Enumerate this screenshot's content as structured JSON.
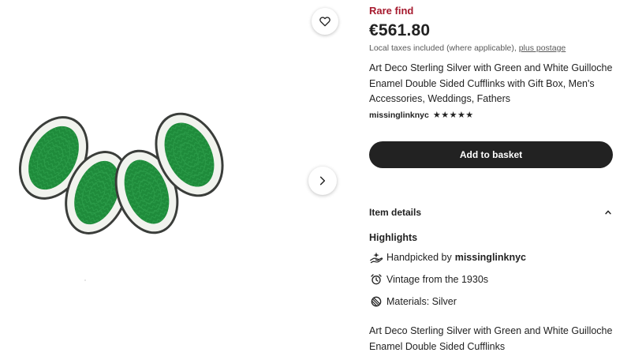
{
  "product": {
    "rare_label": "Rare find",
    "price": "€561.80",
    "taxes_text": "Local taxes included (where applicable),",
    "taxes_link": "plus postage",
    "title": "Art Deco Sterling Silver with Green and White Guilloche Enamel Double Sided Cufflinks with Gift Box, Men's Accessories, Weddings, Fathers",
    "shop_name": "missinglinknyc",
    "rating_stars": "★★★★★",
    "rating_value": 5,
    "add_to_basket_label": "Add to basket"
  },
  "gallery": {
    "favorite_icon": "heart-icon",
    "next_icon": "chevron-right-icon"
  },
  "details": {
    "toggle_label": "Item details",
    "toggle_icon": "chevron-up-icon",
    "highlights_title": "Highlights",
    "highlights": [
      {
        "icon": "hand-icon",
        "prefix": "Handpicked by",
        "bold": "missinglinknyc"
      },
      {
        "icon": "alarm-clock-icon",
        "text": "Vintage from the 1930s"
      },
      {
        "icon": "materials-icon",
        "text": "Materials: Silver"
      }
    ],
    "description": "Art Deco Sterling Silver with Green and White Guilloche Enamel Double Sided Cufflinks"
  },
  "colors": {
    "rare": "#a61a2e",
    "button_bg": "#222222",
    "enamel_green": "#1e8a3a",
    "enamel_white": "#f1f3ee"
  }
}
